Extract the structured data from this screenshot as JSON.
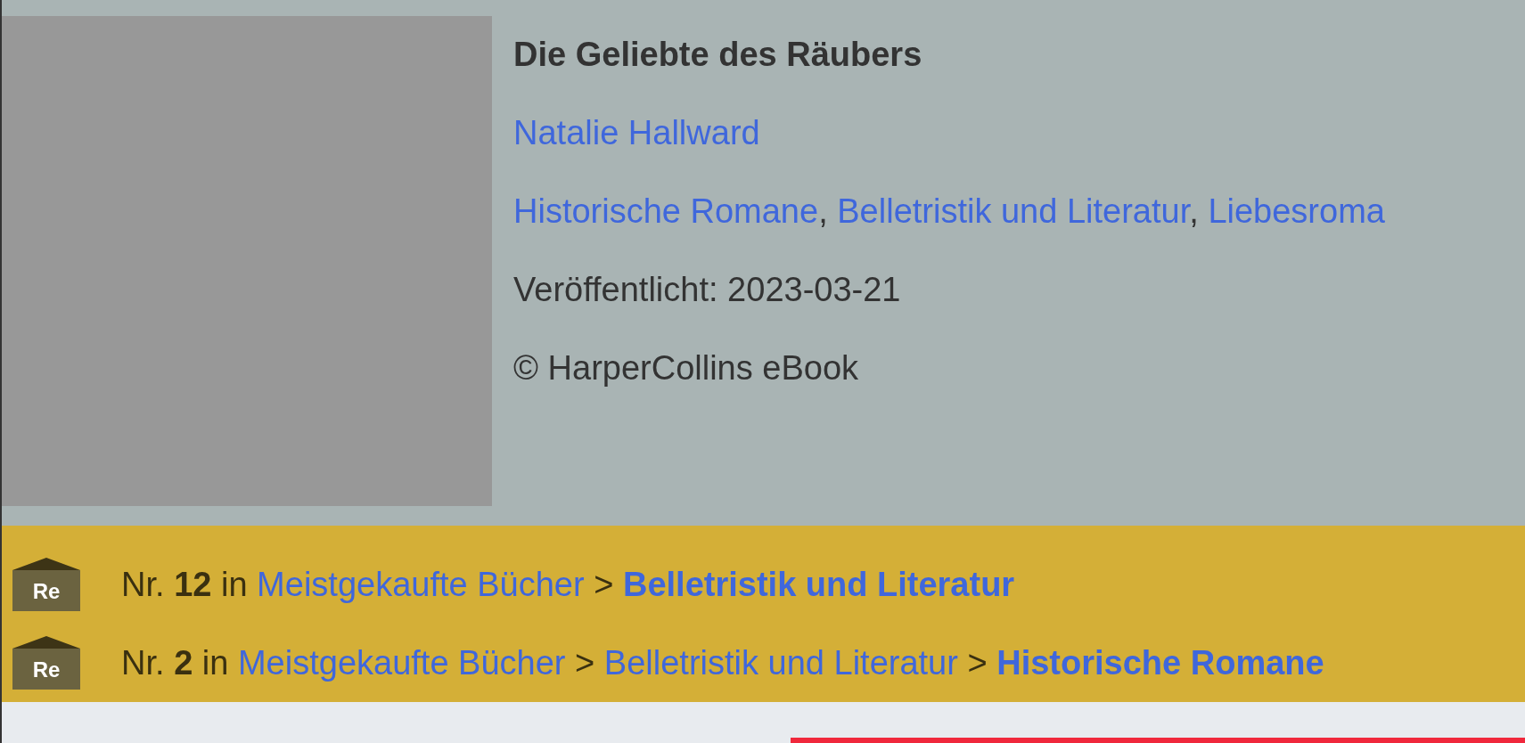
{
  "book": {
    "title": "Die Geliebte des Räubers",
    "author": "Natalie Hallward",
    "categories": [
      {
        "label": "Historische Romane",
        "separator": ","
      },
      {
        "label": "Belletristik und Literatur",
        "separator": ","
      },
      {
        "label": "Liebesroma"
      }
    ],
    "published": "Veröffentlicht: 2023-03-21",
    "copyright": "© HarperCollins eBook"
  },
  "rankings": [
    {
      "badge": "Re",
      "text": "Nr. **12** in",
      "path": [
        {
          "label": "Meistgekaufte Bücher",
          "current": false
        },
        {
          "separator": ">",
          "label": "Belletristik und Literatur",
          "current": true
        }
      ]
    },
    {
      "badge": "Re",
      "text": "Nr. **2** in",
      "path": [
        {
          "label": "Meistgekaufte Bücher",
          "current": false
        },
        {
          "separator": ">",
          "label": "Belletristik und Literatur",
          "current": false
        },
        {
          "separator": ">",
          "label": "Historische Romane",
          "current": true
        }
      ]
    }
  ]
}
